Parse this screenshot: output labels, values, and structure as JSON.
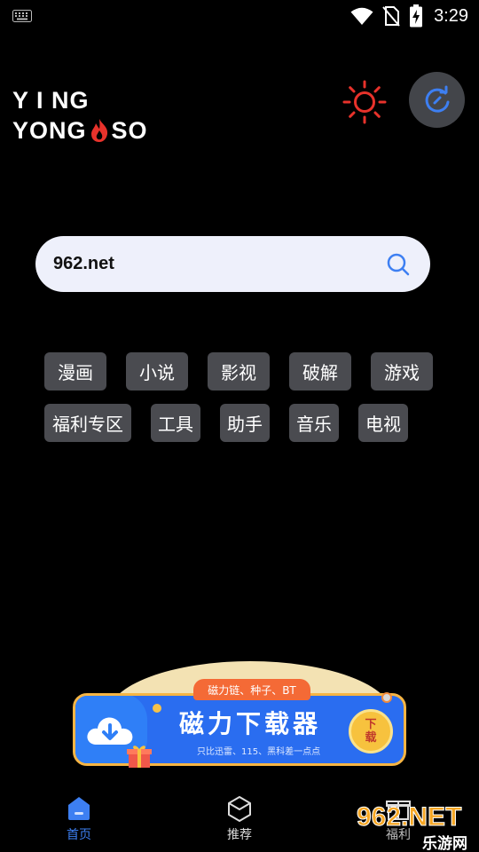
{
  "status_bar": {
    "time": "3:29",
    "icons": [
      "keyboard-icon",
      "wifi-icon",
      "no-sim-icon",
      "battery-charging-icon"
    ]
  },
  "logo": {
    "line1": "Y I NG",
    "line2_left": "YONG",
    "line2_right": "SO",
    "icon": "flame-icon"
  },
  "header": {
    "theme_icon": "sun-icon",
    "refresh_icon": "refresh-icon",
    "accent": "#e8322b",
    "refresh_accent": "#3d7ff2"
  },
  "search": {
    "value": "962.net",
    "icon": "search-icon"
  },
  "tags": [
    "漫画",
    "小说",
    "影视",
    "破解",
    "游戏",
    "福利专区",
    "工具",
    "助手",
    "音乐",
    "电视"
  ],
  "banner": {
    "tagline": "磁力链、种子、BT",
    "title": "磁力下载器",
    "subtitle": "只比迅雷、115、黑科差一点点",
    "button": "下载"
  },
  "nav": {
    "items": [
      {
        "label": "首页",
        "icon": "home-icon",
        "active": true
      },
      {
        "label": "推荐",
        "icon": "cube-icon",
        "active": false
      },
      {
        "label": "福利",
        "icon": "gift-icon",
        "active": false
      }
    ],
    "active_color": "#3d7ff2"
  },
  "watermark": {
    "brand": "962.NET",
    "sub": "乐游网"
  }
}
